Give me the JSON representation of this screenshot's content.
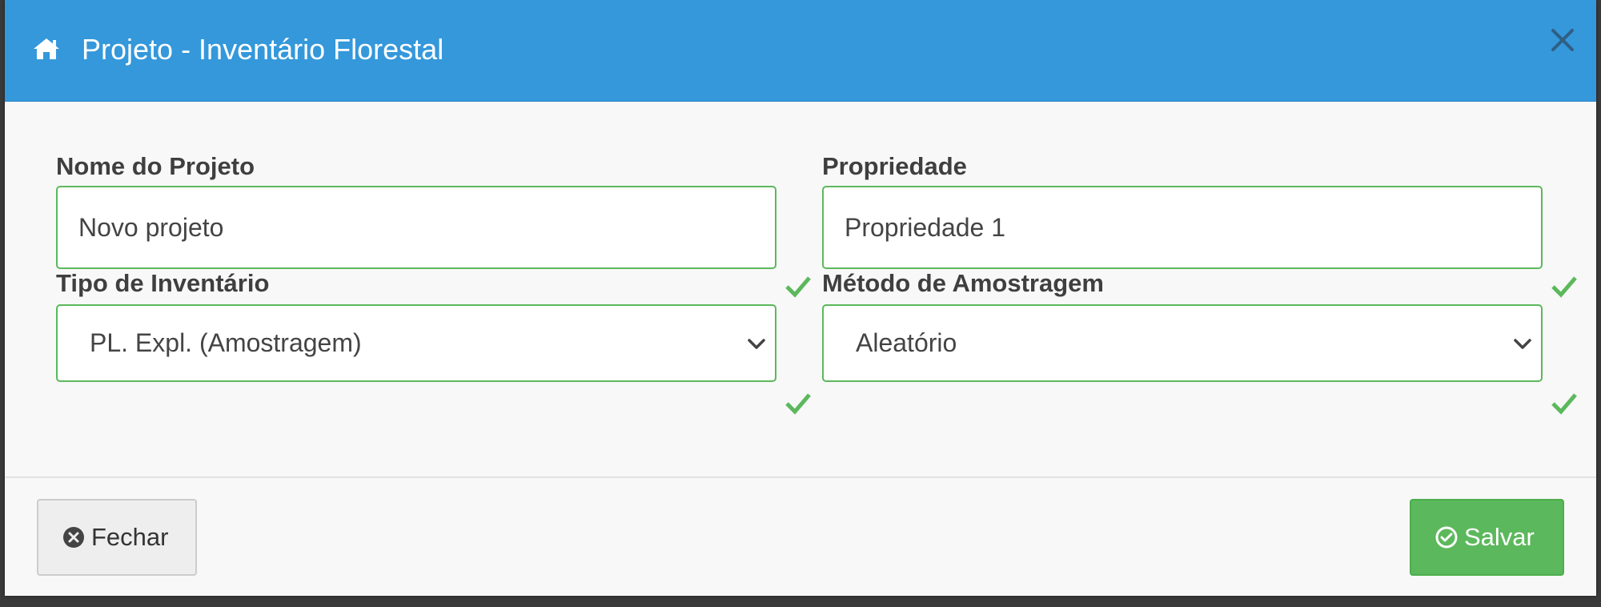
{
  "modal": {
    "title": "Projeto - Inventário Florestal",
    "header_color": "#3498db",
    "icons": {
      "title": "home-icon",
      "close": "close-icon"
    }
  },
  "fields": {
    "project_name": {
      "label": "Nome do Projeto",
      "value": "Novo projeto",
      "valid": true
    },
    "property": {
      "label": "Propriedade",
      "value": "Propriedade 1",
      "valid": true
    },
    "inventory_type": {
      "label": "Tipo de Inventário",
      "selected": "PL. Expl. (Amostragem)",
      "valid": true
    },
    "sampling_method": {
      "label": "Método de Amostragem",
      "selected": "Aleatório",
      "valid": true
    }
  },
  "footer": {
    "close_label": "Fechar",
    "save_label": "Salvar",
    "close_icon": "times-circle-icon",
    "save_icon": "check-circle-icon",
    "save_color": "#5cb85c"
  },
  "valid_color": "#5cb85c"
}
